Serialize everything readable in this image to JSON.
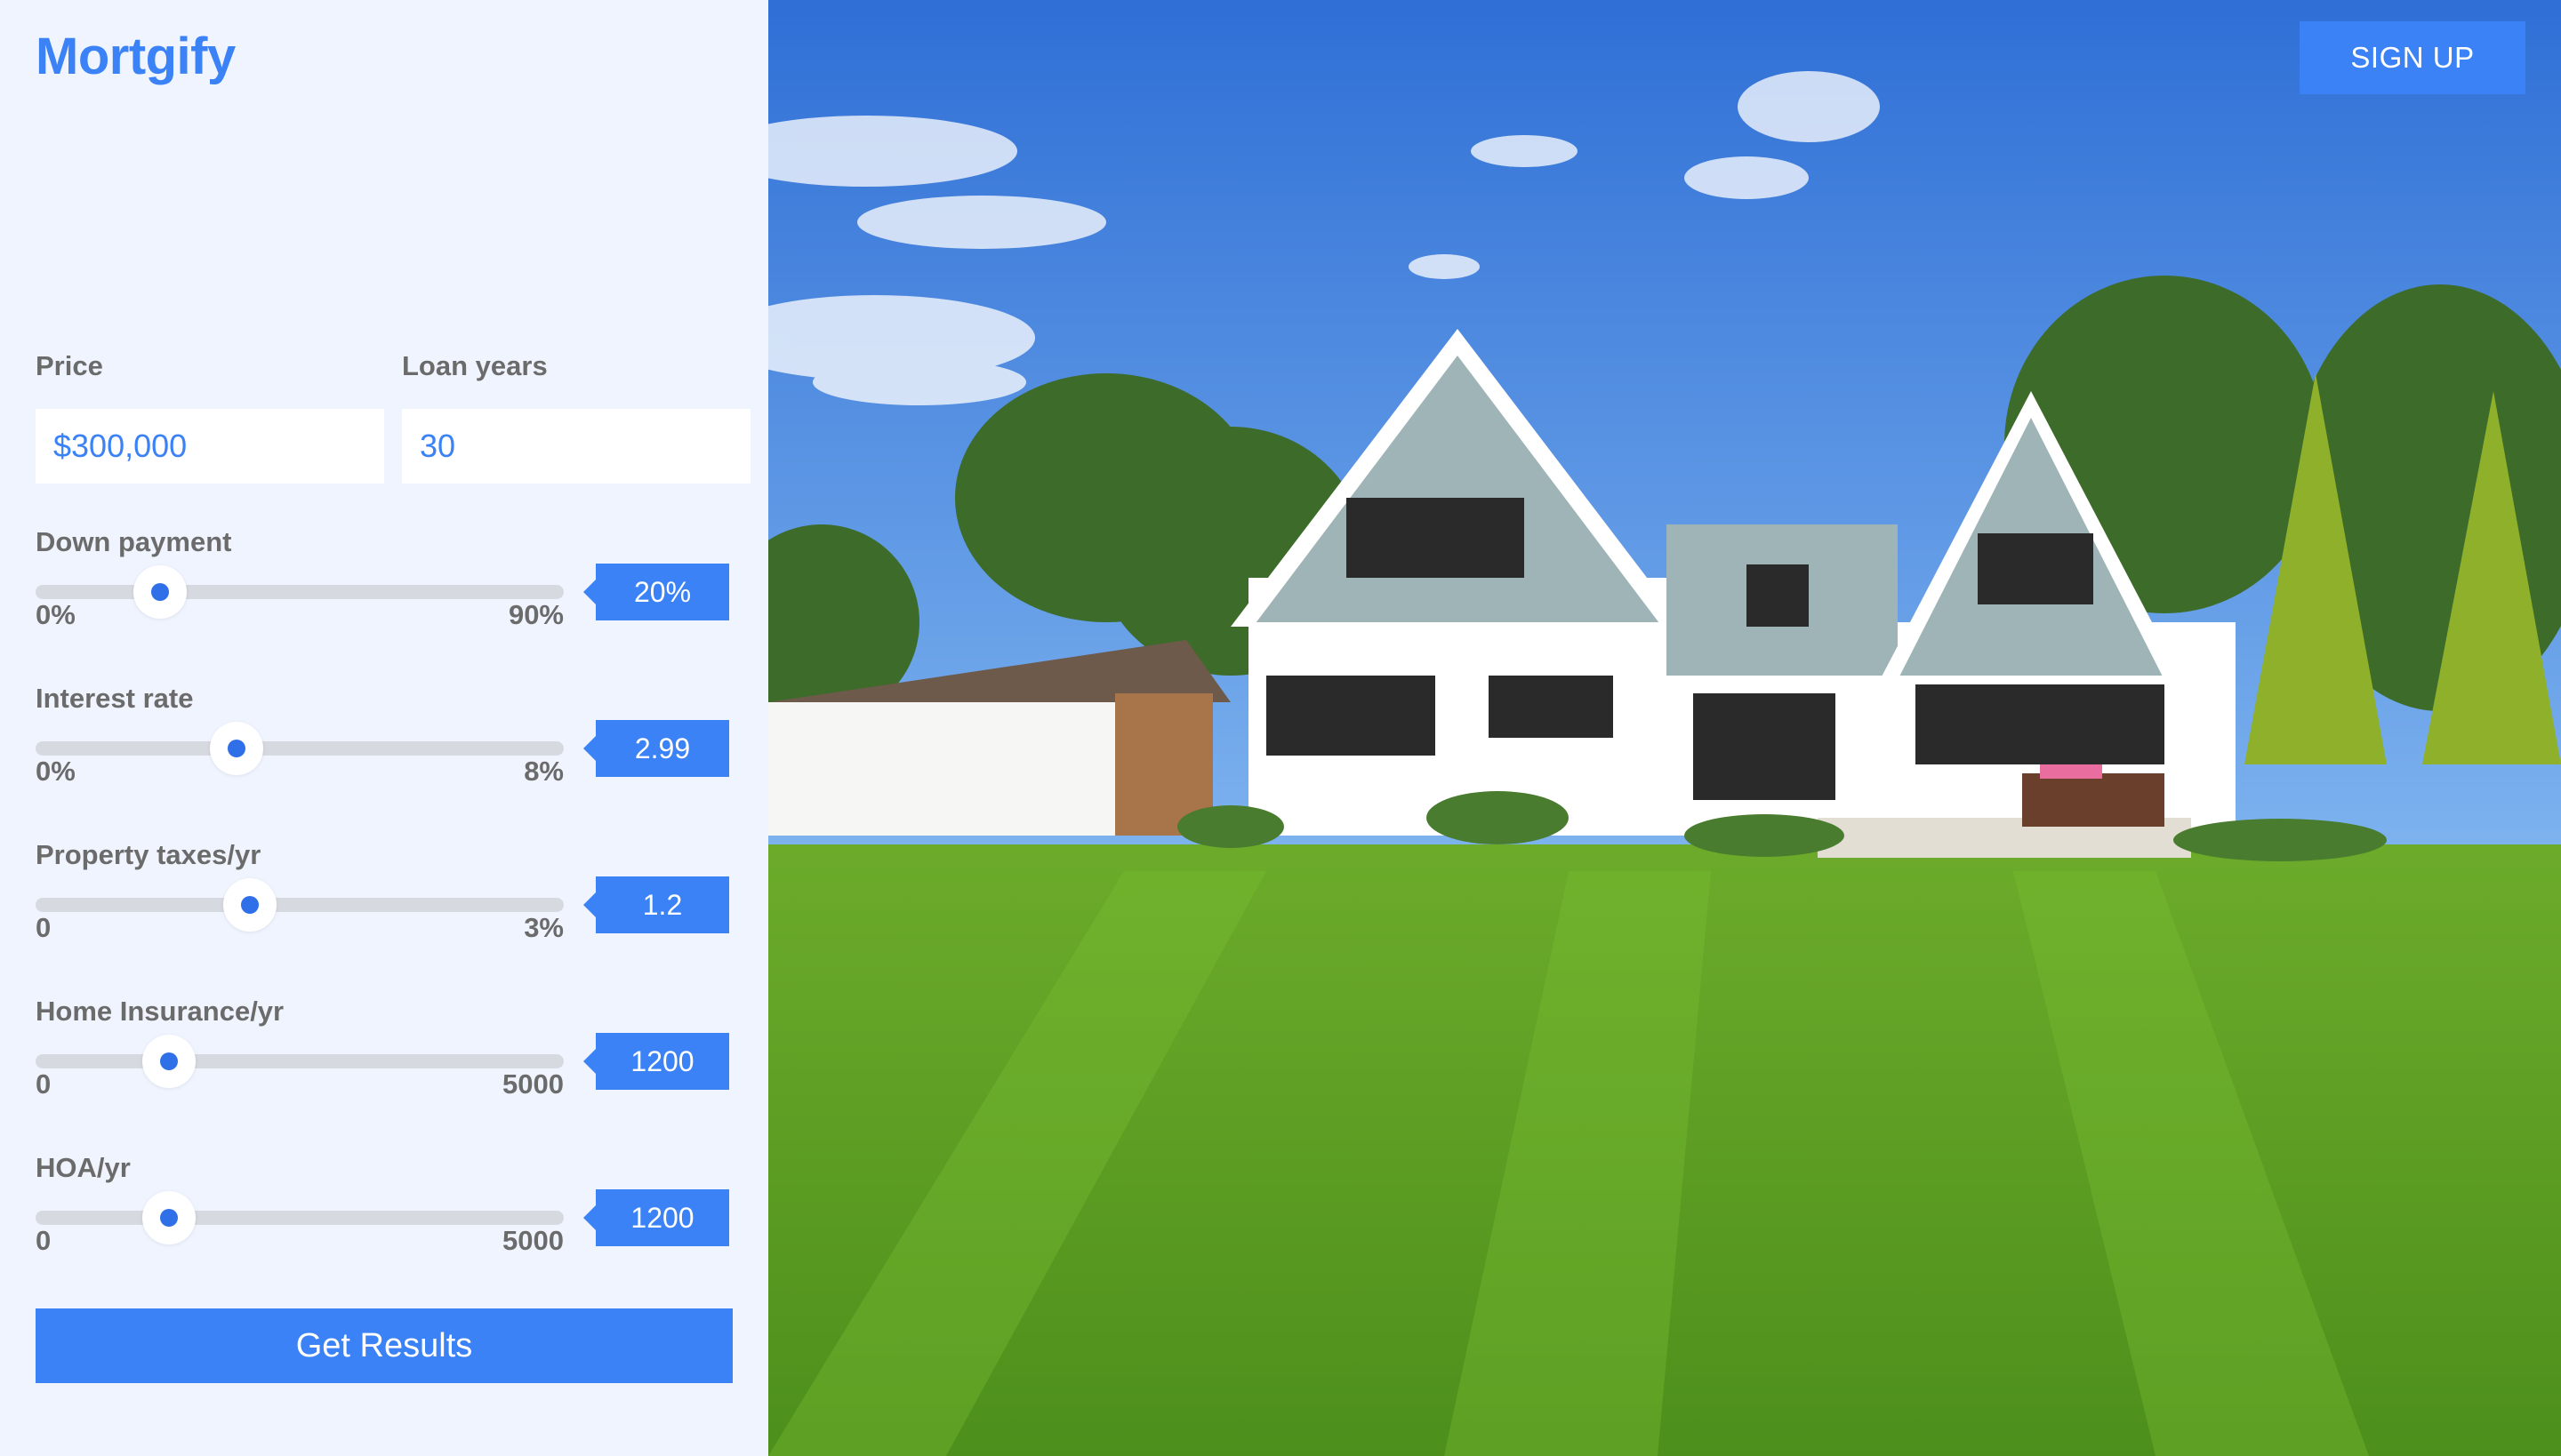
{
  "app": {
    "brand": "Mortgify",
    "accent_color": "#3b82f6",
    "panel_background": "#eff4fe"
  },
  "header": {
    "signup_label": "SIGN UP"
  },
  "inputs": {
    "price": {
      "label": "Price",
      "value": "$300,000"
    },
    "loan_years": {
      "label": "Loan years",
      "value": "30"
    }
  },
  "sliders": [
    {
      "label": "Down payment",
      "min_label": "0%",
      "max_label": "90%",
      "display": "20%",
      "min": 0,
      "max": 90,
      "value": 20
    },
    {
      "label": "Interest rate",
      "min_label": "0%",
      "max_label": "8%",
      "display": "2.99",
      "min": 0,
      "max": 8,
      "value": 2.99
    },
    {
      "label": "Property taxes/yr",
      "min_label": "0",
      "max_label": "3%",
      "display": "1.2",
      "min": 0,
      "max": 3,
      "value": 1.2
    },
    {
      "label": "Home Insurance/yr",
      "min_label": "0",
      "max_label": "5000",
      "display": "1200",
      "min": 0,
      "max": 5000,
      "value": 1200
    },
    {
      "label": "HOA/yr",
      "min_label": "0",
      "max_label": "5000",
      "display": "1200",
      "min": 0,
      "max": 5000,
      "value": 1200
    }
  ],
  "actions": {
    "results_label": "Get Results"
  }
}
